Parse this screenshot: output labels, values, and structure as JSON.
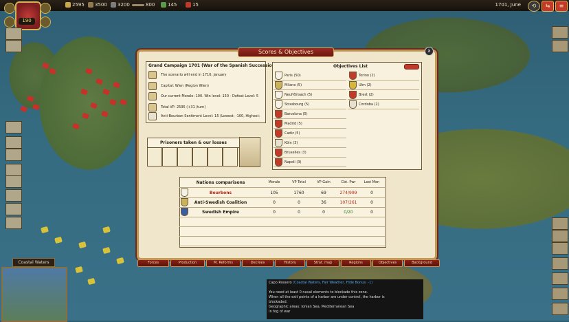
{
  "topbar": {
    "resources": [
      {
        "value": "2595",
        "color": "#c9a84a"
      },
      {
        "value": "3500",
        "color": "#8f7a52"
      },
      {
        "value": "3200",
        "color": "#7d7d7d"
      },
      {
        "value": "800",
        "color": "#9a8a6a"
      },
      {
        "value": "145",
        "color": "#5a9a4a"
      },
      {
        "value": "15",
        "color": "#c03a2a"
      }
    ],
    "date": "1701, June",
    "crest_number": "190"
  },
  "minimap": {
    "title": "Coastal Waters"
  },
  "dialog": {
    "title": "Scores & Objectives",
    "close": "x",
    "campaign": {
      "title": "Grand Campaign 1701 (War of the Spanish Succession",
      "rows": [
        {
          "text": "The scenario will end in 1716, January"
        },
        {
          "text": "Capital: Wien (Region Wien)"
        },
        {
          "text": "Our current Morale: 100. Win level: 150 - Defeat Level: 5"
        },
        {
          "text": "Total VP: 2595 (+31 /turn)"
        },
        {
          "text": "Anti-Bourbon Sentiment Level: 15  (Lowest: -100, Highest:"
        }
      ]
    },
    "objectives": {
      "title": "Objectives List",
      "left": [
        "Paris (50)",
        "Milano (5)",
        "Neuf-Brisach (5)",
        "Strasbourg (5)",
        "Barcelona (5)",
        "Madrid (5)",
        "Cadiz (5)",
        "Köln (3)",
        "Bruxelles (3)",
        "Napoli (3)"
      ],
      "right": [
        "Torino (2)",
        "Ulm (2)",
        "Brest (2)",
        "Cordoba (2)"
      ]
    },
    "prisoners": {
      "title": "Prisoners taken & our losses"
    },
    "comparisons": {
      "headers": [
        "Nations comparisons",
        "Morale",
        "VP Total",
        "VP Gain",
        "Cbt. Pwr",
        "Lost Men"
      ],
      "rows": [
        {
          "name": "Bourbons",
          "morale": "105",
          "vp_total": "1760",
          "vp_gain": "69",
          "cbt_pwr": "274/999",
          "lost_men": "0"
        },
        {
          "name": "Anti-Swedish Coalition",
          "morale": "0",
          "vp_total": "0",
          "vp_gain": "36",
          "cbt_pwr": "107/261",
          "lost_men": "0"
        },
        {
          "name": "Swedish Empire",
          "morale": "0",
          "vp_total": "0",
          "vp_gain": "0",
          "cbt_pwr": "0/20",
          "lost_men": "0"
        }
      ]
    },
    "tabs": [
      "Forces",
      "Production",
      "M. Reforms",
      "Decrees",
      "History",
      "Strat. map",
      "Regions",
      "Objectives",
      "Background"
    ]
  },
  "tooltip": {
    "title": "Capo Passero",
    "detail": "(Coastal Waters, Fair Weather, Hide Bonus: -1)",
    "line1": "You need at least 0 naval elements to blockade this zone.",
    "line2": "When all the exit points of a harbor are under control, the harbor is",
    "line3": "blockaded.",
    "line4": "Geographic areas: Ionian Sea, Mediterranean Sea",
    "line5": "In fog of war"
  }
}
